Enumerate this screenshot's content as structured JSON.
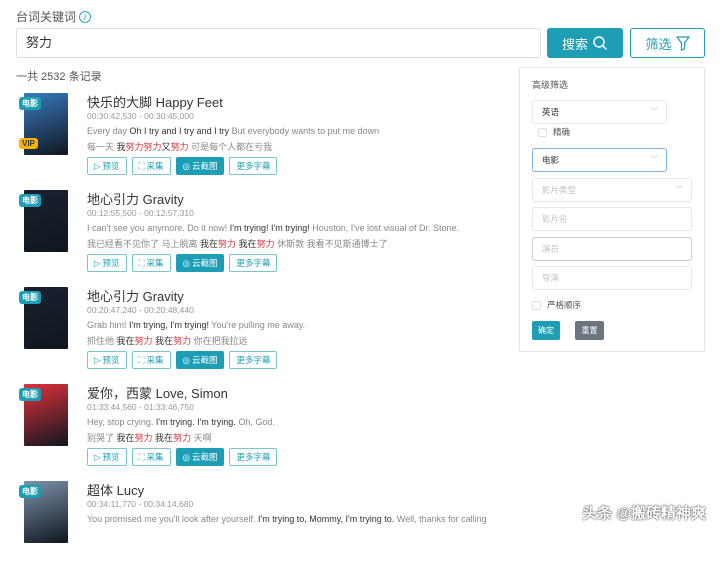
{
  "header": {
    "label": "台词关键词",
    "info_icon": "i",
    "search_value": "努力",
    "search_button": "搜索",
    "filter_button": "筛选"
  },
  "result_count": "一共 2532 条记录",
  "items": [
    {
      "title": "快乐的大脚 Happy Feet",
      "time": "00:30:42,530 - 00:30:45,000",
      "tag": "电影",
      "vip": "VIP",
      "poster_color": "#3a7bbf",
      "en": [
        {
          "t": "Every day  ",
          "s": ""
        },
        {
          "t": "Oh I try and I try and I try",
          "s": "hl"
        },
        {
          "t": " But everybody wants to put me down",
          "s": ""
        }
      ],
      "zh": [
        {
          "t": "每一天  ",
          "s": ""
        },
        {
          "t": "我",
          "s": "hl"
        },
        {
          "t": "努力努力",
          "s": "red"
        },
        {
          "t": "又",
          "s": "hl"
        },
        {
          "t": "努力",
          "s": "red"
        },
        {
          "t": " 可是每个人都在亏我",
          "s": ""
        }
      ]
    },
    {
      "title": "地心引力 Gravity",
      "time": "00:12:55,500 - 00:12:57,310",
      "tag": "电影",
      "poster_color": "#1a2230",
      "en": [
        {
          "t": "I can't see you anymore. Do it now!  ",
          "s": ""
        },
        {
          "t": "I'm trying! I'm trying!",
          "s": "hl"
        },
        {
          "t": " Houston, I've lost visual of Dr. Stone.",
          "s": ""
        }
      ],
      "zh": [
        {
          "t": "我已经看不见你了 马上脱离  ",
          "s": ""
        },
        {
          "t": "我在",
          "s": "hl"
        },
        {
          "t": "努力",
          "s": "red"
        },
        {
          "t": " 我在",
          "s": "hl"
        },
        {
          "t": "努力",
          "s": "red"
        },
        {
          "t": " 休斯敦 我看不见斯通博士了",
          "s": ""
        }
      ]
    },
    {
      "title": "地心引力 Gravity",
      "time": "00:20:47,240 - 00:20:48,440",
      "tag": "电影",
      "poster_color": "#1a2230",
      "en": [
        {
          "t": "Grab him!  ",
          "s": ""
        },
        {
          "t": "I'm trying, I'm trying!",
          "s": "hl"
        },
        {
          "t": " You're pulling me away.",
          "s": ""
        }
      ],
      "zh": [
        {
          "t": "抓住他  ",
          "s": ""
        },
        {
          "t": "我在",
          "s": "hl"
        },
        {
          "t": "努力",
          "s": "red"
        },
        {
          "t": " 我在",
          "s": "hl"
        },
        {
          "t": "努力",
          "s": "red"
        },
        {
          "t": " 你在把我拉远",
          "s": ""
        }
      ]
    },
    {
      "title": "爱你，西蒙 Love, Simon",
      "time": "01:33:44,560 - 01:33:46,750",
      "tag": "电影",
      "poster_color": "#e0323a",
      "en": [
        {
          "t": "Hey, stop crying.  ",
          "s": ""
        },
        {
          "t": "I'm trying. I'm trying.",
          "s": "hl"
        },
        {
          "t": " Oh, God.",
          "s": ""
        }
      ],
      "zh": [
        {
          "t": "别哭了  ",
          "s": ""
        },
        {
          "t": "我在",
          "s": "hl"
        },
        {
          "t": "努力",
          "s": "red"
        },
        {
          "t": " 我在",
          "s": "hl"
        },
        {
          "t": "努力",
          "s": "red"
        },
        {
          "t": " 天啊",
          "s": ""
        }
      ]
    },
    {
      "title": "超体 Lucy",
      "time": "00:34:11,770 - 00:34:14,680",
      "tag": "电影",
      "poster_color": "#7e93ad",
      "en": [
        {
          "t": "You promised me you'll look after yourself.  ",
          "s": ""
        },
        {
          "t": "I'm trying to, Mommy, I'm trying to.",
          "s": "hl"
        },
        {
          "t": " Well, thanks for calling",
          "s": ""
        }
      ],
      "zh": []
    }
  ],
  "item_buttons": {
    "preview": "预览",
    "collect": "采集",
    "screenshot": "云截图",
    "more": "更多字幕"
  },
  "filter_panel": {
    "title": "高级筛选",
    "language": "英语",
    "exact": "精确",
    "category": "电影",
    "genre_placeholder": "影片类型",
    "name_placeholder": "影片名",
    "actor_placeholder": "演员",
    "director_placeholder": "导演",
    "strict_order": "严格顺序",
    "confirm": "确定",
    "reset": "重置"
  },
  "watermark": "头条 @搬砖精神爽"
}
